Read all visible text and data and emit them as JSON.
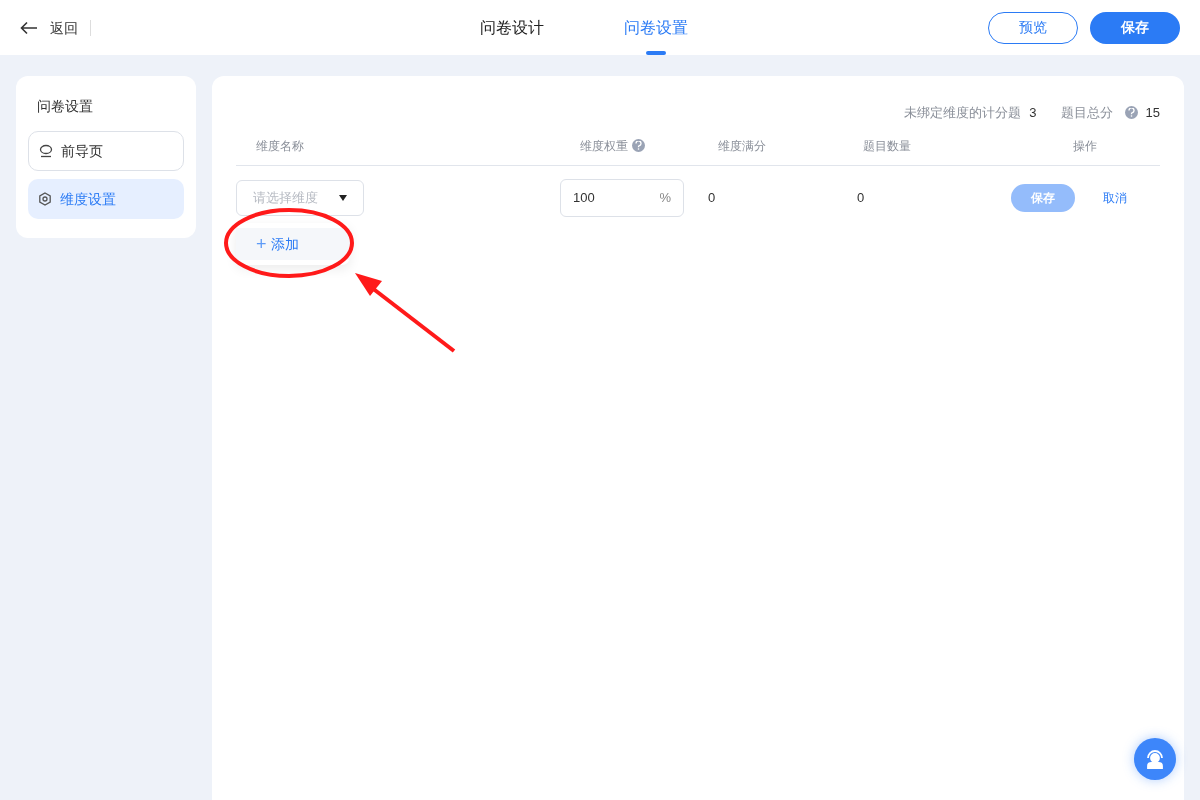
{
  "header": {
    "back": "返回",
    "tabs": [
      {
        "label": "问卷设计",
        "selected": false
      },
      {
        "label": "问卷设置",
        "selected": true
      }
    ],
    "buttons": [
      {
        "label": "预览",
        "kind": "outline"
      },
      {
        "label": "保存",
        "kind": "primary"
      }
    ]
  },
  "sidebar": {
    "title": "问卷设置",
    "items": [
      {
        "label": "前导页",
        "selected": false
      },
      {
        "label": "维度设置",
        "selected": true
      }
    ]
  },
  "summary": [
    {
      "label": "未绑定维度的计分题",
      "value": "3",
      "help": false
    },
    {
      "label": "题目总分",
      "value": "15",
      "help": true
    }
  ],
  "table": {
    "columns": [
      {
        "label": "维度名称",
        "help": false
      },
      {
        "label": "维度权重",
        "help": true
      },
      {
        "label": "维度满分",
        "help": false
      },
      {
        "label": "题目数量",
        "help": false
      },
      {
        "label": "操作",
        "help": false
      }
    ],
    "row": {
      "dimension": {
        "placeholder": "请选择维度"
      },
      "weight": "100",
      "unit": "%",
      "full_score": "0",
      "question_count": "0",
      "save": {
        "label": "保存",
        "disabled": true
      },
      "cancel": "取消"
    }
  },
  "dropdown": {
    "items": [
      {
        "icon": "+",
        "label": "添加"
      }
    ]
  }
}
